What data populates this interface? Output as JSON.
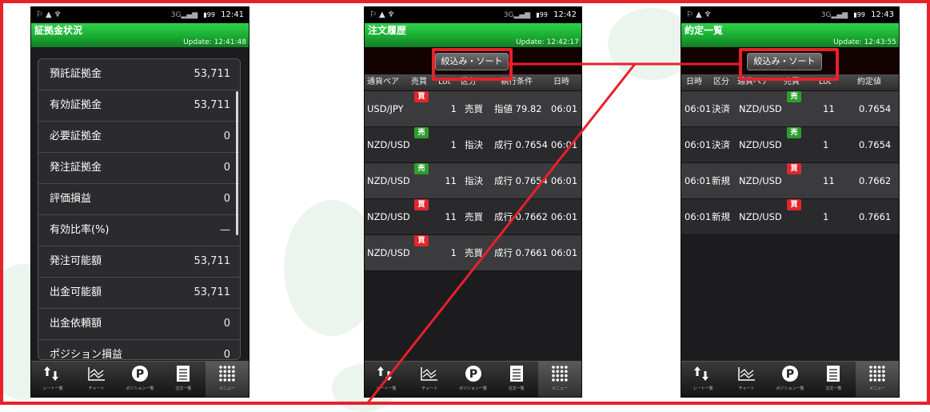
{
  "statusbar": {
    "signal": "3G",
    "battery": "99",
    "phone1_time": "12:41",
    "phone2_time": "12:42",
    "phone3_time": "12:43"
  },
  "phone1": {
    "title": "証拠金状況",
    "update": "Update: 12:41:48",
    "rows": [
      {
        "label": "預託証拠金",
        "value": "53,711"
      },
      {
        "label": "有効証拠金",
        "value": "53,711"
      },
      {
        "label": "必要証拠金",
        "value": "0"
      },
      {
        "label": "発注証拠金",
        "value": "0"
      },
      {
        "label": "評価損益",
        "value": "0"
      },
      {
        "label": "有効比率(%)",
        "value": "—"
      },
      {
        "label": "発注可能額",
        "value": "53,711"
      },
      {
        "label": "出金可能額",
        "value": "53,711"
      },
      {
        "label": "出金依頼額",
        "value": "0"
      },
      {
        "label": "ポジション損益",
        "value": "0"
      }
    ]
  },
  "phone2": {
    "title": "注文履歴",
    "update": "Update: 12:42:17",
    "filter_label": "絞込み・ソート",
    "columns": [
      "通貨ペア",
      "売買",
      "Lot",
      "区分",
      "執行条件",
      "日時"
    ],
    "rows": [
      {
        "pair": "USD/JPY",
        "side": "買",
        "side_type": "buy",
        "lot": "1",
        "kind": "売買",
        "condition": "指値 79.82",
        "time": "06:01"
      },
      {
        "pair": "NZD/USD",
        "side": "売",
        "side_type": "sell",
        "lot": "1",
        "kind": "指決",
        "condition": "成行 0.7654",
        "time": "06:01"
      },
      {
        "pair": "NZD/USD",
        "side": "売",
        "side_type": "sell",
        "lot": "11",
        "kind": "指決",
        "condition": "成行 0.7654",
        "time": "06:01"
      },
      {
        "pair": "NZD/USD",
        "side": "買",
        "side_type": "buy",
        "lot": "11",
        "kind": "売買",
        "condition": "成行 0.7662",
        "time": "06:01"
      },
      {
        "pair": "NZD/USD",
        "side": "買",
        "side_type": "buy",
        "lot": "1",
        "kind": "売買",
        "condition": "成行 0.7661",
        "time": "06:01"
      }
    ]
  },
  "phone3": {
    "title": "約定一覧",
    "update": "Update: 12:43:55",
    "filter_label": "絞込み・ソート",
    "columns": [
      "日時",
      "区分",
      "通貨ペア",
      "売買",
      "Lot",
      "約定値"
    ],
    "rows": [
      {
        "time": "06:01",
        "kind": "決済",
        "pair": "NZD/USD",
        "side": "売",
        "side_type": "sell",
        "lot": "11",
        "price": "0.7654"
      },
      {
        "time": "06:01",
        "kind": "決済",
        "pair": "NZD/USD",
        "side": "売",
        "side_type": "sell",
        "lot": "1",
        "price": "0.7654"
      },
      {
        "time": "06:01",
        "kind": "新規",
        "pair": "NZD/USD",
        "side": "買",
        "side_type": "buy",
        "lot": "11",
        "price": "0.7662"
      },
      {
        "time": "06:01",
        "kind": "新規",
        "pair": "NZD/USD",
        "side": "買",
        "side_type": "buy",
        "lot": "1",
        "price": "0.7661"
      }
    ]
  },
  "nav": [
    {
      "label": "レート一覧",
      "icon": "rate-arrows-icon"
    },
    {
      "label": "チャート",
      "icon": "chart-icon"
    },
    {
      "label": "ポジション一覧",
      "icon": "position-p-icon"
    },
    {
      "label": "注文一覧",
      "icon": "order-list-icon"
    },
    {
      "label": "メニュー",
      "icon": "menu-grid-icon"
    }
  ],
  "colors": {
    "annotation_red": "#e8202a",
    "title_green": "#1fbf3a",
    "buy_badge": "#e2262e",
    "sell_badge": "#2f9e2f"
  }
}
